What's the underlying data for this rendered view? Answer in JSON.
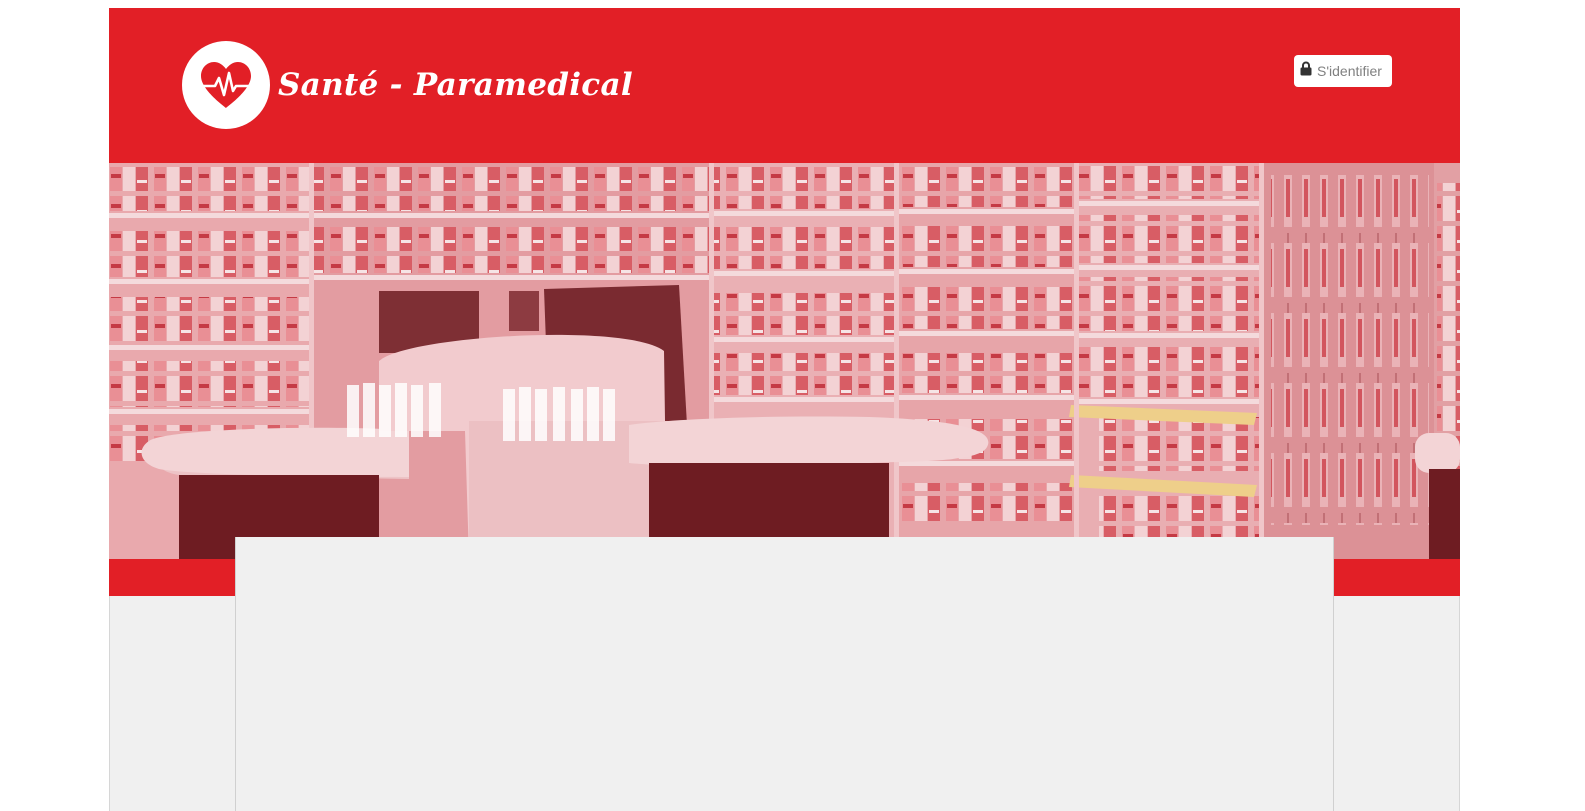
{
  "header": {
    "site_title": "Santé - Paramedical",
    "logo_icon": "heart-pulse-icon",
    "login": {
      "label": "S'identifier",
      "icon": "lock-icon"
    }
  },
  "hero": {
    "image": "pharmacy-interior-photo"
  },
  "colors": {
    "brand_red": "#e21f26",
    "content_background": "#f0f0f0",
    "button_text": "#808080"
  }
}
